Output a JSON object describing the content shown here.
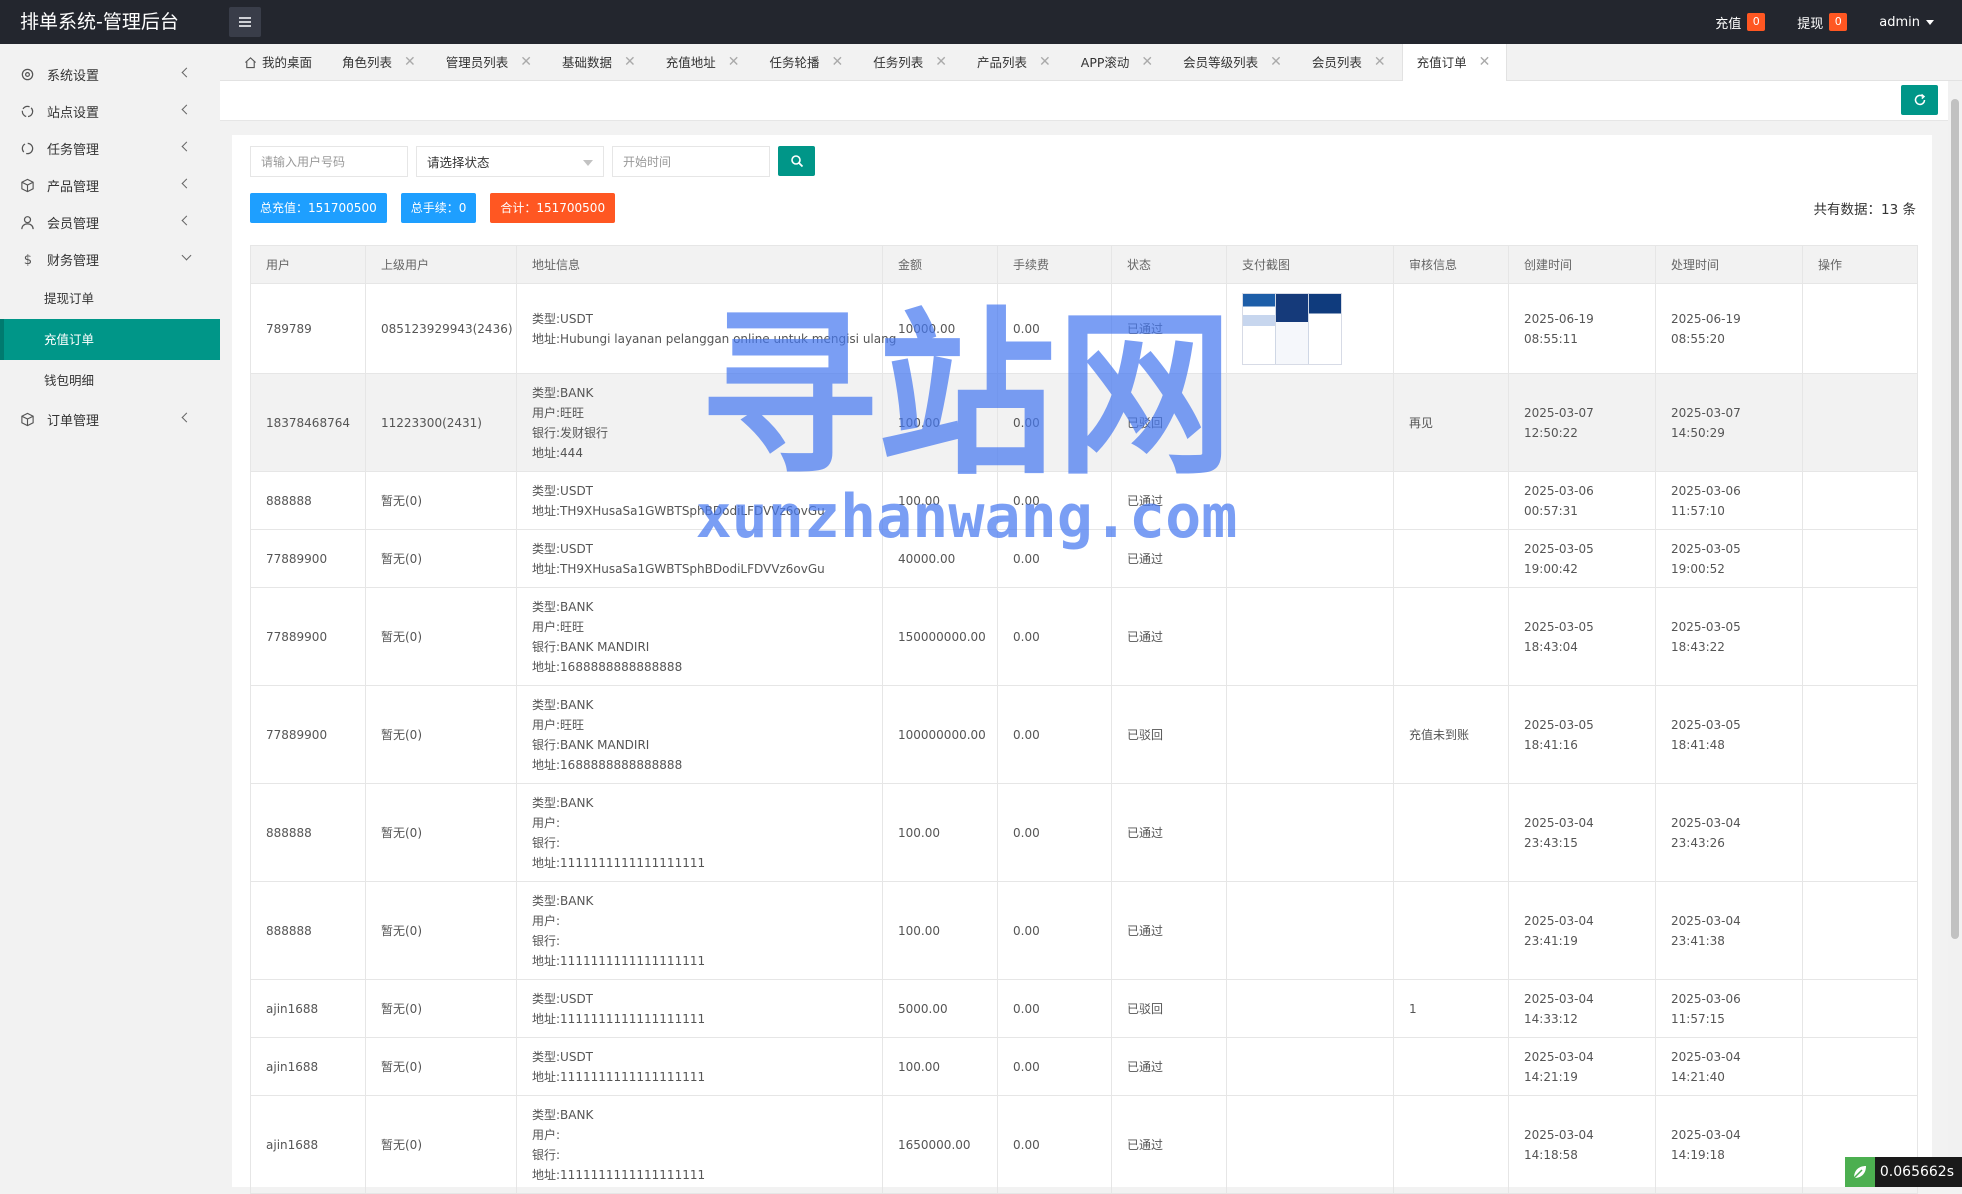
{
  "app": {
    "title": "排单系统-管理后台"
  },
  "header": {
    "recharge_label": "充值",
    "recharge_count": "0",
    "withdraw_label": "提现",
    "withdraw_count": "0",
    "user": "admin"
  },
  "sidebar": {
    "items": [
      {
        "label": "系统设置",
        "icon": "gear-icon"
      },
      {
        "label": "站点设置",
        "icon": "site-icon"
      },
      {
        "label": "任务管理",
        "icon": "task-icon"
      },
      {
        "label": "产品管理",
        "icon": "box-icon"
      },
      {
        "label": "会员管理",
        "icon": "user-icon"
      },
      {
        "label": "财务管理",
        "icon": "dollar-icon"
      },
      {
        "label": "订单管理",
        "icon": "box-icon"
      }
    ],
    "finance_sub": [
      {
        "label": "提现订单"
      },
      {
        "label": "充值订单"
      },
      {
        "label": "钱包明细"
      }
    ]
  },
  "tabs": [
    {
      "label": "我的桌面"
    },
    {
      "label": "角色列表"
    },
    {
      "label": "管理员列表"
    },
    {
      "label": "基础数据"
    },
    {
      "label": "充值地址"
    },
    {
      "label": "任务轮播"
    },
    {
      "label": "任务列表"
    },
    {
      "label": "产品列表"
    },
    {
      "label": "APP滚动"
    },
    {
      "label": "会员等级列表"
    },
    {
      "label": "会员列表"
    },
    {
      "label": "充值订单"
    }
  ],
  "filters": {
    "user_placeholder": "请输入用户号码",
    "status_placeholder": "请选择状态",
    "time_placeholder": "开始时间"
  },
  "stats": {
    "total_recharge": "总充值：151700500",
    "total_fee": "总手续：0",
    "sum": "合计：151700500",
    "total_count": "共有数据：13 条"
  },
  "table": {
    "headers": [
      "用户",
      "上级用户",
      "地址信息",
      "金额",
      "手续费",
      "状态",
      "支付截图",
      "审核信息",
      "创建时间",
      "处理时间",
      "操作"
    ],
    "rows": [
      {
        "user": "789789",
        "parent": "085123929943(2436)",
        "addr": [
          "类型:USDT",
          "地址:Hubungi layanan pelanggan online untuk mengisi ulang"
        ],
        "amount": "10000.00",
        "fee": "0.00",
        "status": "已通过",
        "review": "",
        "created": "2025-06-19 08:55:11",
        "processed": "2025-06-19 08:55:20"
      },
      {
        "user": "18378468764",
        "parent": "11223300(2431)",
        "addr": [
          "类型:BANK",
          "用户:旺旺",
          "银行:发财银行",
          "地址:444"
        ],
        "amount": "100.00",
        "fee": "0.00",
        "status": "已驳回",
        "review": "再见",
        "created": "2025-03-07 12:50:22",
        "processed": "2025-03-07 14:50:29"
      },
      {
        "user": "888888",
        "parent": "暂无(0)",
        "addr": [
          "类型:USDT",
          "地址:TH9XHusaSa1GWBTSphBDodiLFDVVz6ovGu"
        ],
        "amount": "100.00",
        "fee": "0.00",
        "status": "已通过",
        "review": "",
        "created": "2025-03-06 00:57:31",
        "processed": "2025-03-06 11:57:10"
      },
      {
        "user": "77889900",
        "parent": "暂无(0)",
        "addr": [
          "类型:USDT",
          "地址:TH9XHusaSa1GWBTSphBDodiLFDVVz6ovGu"
        ],
        "amount": "40000.00",
        "fee": "0.00",
        "status": "已通过",
        "review": "",
        "created": "2025-03-05 19:00:42",
        "processed": "2025-03-05 19:00:52"
      },
      {
        "user": "77889900",
        "parent": "暂无(0)",
        "addr": [
          "类型:BANK",
          "用户:旺旺",
          "银行:BANK MANDIRI",
          "地址:1688888888888888"
        ],
        "amount": "150000000.00",
        "fee": "0.00",
        "status": "已通过",
        "review": "",
        "created": "2025-03-05 18:43:04",
        "processed": "2025-03-05 18:43:22"
      },
      {
        "user": "77889900",
        "parent": "暂无(0)",
        "addr": [
          "类型:BANK",
          "用户:旺旺",
          "银行:BANK MANDIRI",
          "地址:1688888888888888"
        ],
        "amount": "100000000.00",
        "fee": "0.00",
        "status": "已驳回",
        "review": "充值未到账",
        "created": "2025-03-05 18:41:16",
        "processed": "2025-03-05 18:41:48"
      },
      {
        "user": "888888",
        "parent": "暂无(0)",
        "addr": [
          "类型:BANK",
          "用户:",
          "银行:",
          "地址:1111111111111111111"
        ],
        "amount": "100.00",
        "fee": "0.00",
        "status": "已通过",
        "review": "",
        "created": "2025-03-04 23:43:15",
        "processed": "2025-03-04 23:43:26"
      },
      {
        "user": "888888",
        "parent": "暂无(0)",
        "addr": [
          "类型:BANK",
          "用户:",
          "银行:",
          "地址:1111111111111111111"
        ],
        "amount": "100.00",
        "fee": "0.00",
        "status": "已通过",
        "review": "",
        "created": "2025-03-04 23:41:19",
        "processed": "2025-03-04 23:41:38"
      },
      {
        "user": "ajin1688",
        "parent": "暂无(0)",
        "addr": [
          "类型:USDT",
          "地址:1111111111111111111"
        ],
        "amount": "5000.00",
        "fee": "0.00",
        "status": "已驳回",
        "review": "1",
        "created": "2025-03-04 14:33:12",
        "processed": "2025-03-06 11:57:15"
      },
      {
        "user": "ajin1688",
        "parent": "暂无(0)",
        "addr": [
          "类型:USDT",
          "地址:1111111111111111111"
        ],
        "amount": "100.00",
        "fee": "0.00",
        "status": "已通过",
        "review": "",
        "created": "2025-03-04 14:21:19",
        "processed": "2025-03-04 14:21:40"
      },
      {
        "user": "ajin1688",
        "parent": "暂无(0)",
        "addr": [
          "类型:BANK",
          "用户:",
          "银行:",
          "地址:1111111111111111111"
        ],
        "amount": "1650000.00",
        "fee": "0.00",
        "status": "已通过",
        "review": "",
        "created": "2025-03-04 14:18:58",
        "processed": "2025-03-04 14:19:18"
      }
    ]
  },
  "watermark": {
    "cn": "寻站网",
    "en": "xunzhanwang.com"
  },
  "timer": "0.065662s",
  "colors": {
    "header": "#23262e",
    "accent": "#009688",
    "blue": "#1e9fff",
    "orange": "#ff5722"
  }
}
